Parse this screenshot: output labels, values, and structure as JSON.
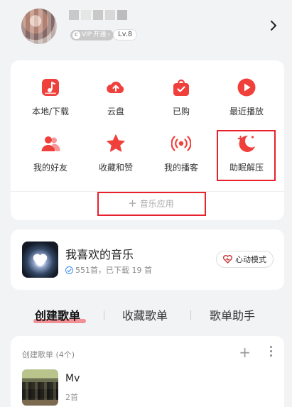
{
  "profile": {
    "vip_badge": "开通",
    "vip_badge_logo": "VIP",
    "level": "Lv.8"
  },
  "grid": {
    "items": [
      {
        "label": "本地/下载",
        "icon": "music-file-icon"
      },
      {
        "label": "云盘",
        "icon": "cloud-upload-icon"
      },
      {
        "label": "已购",
        "icon": "shopping-bag-icon"
      },
      {
        "label": "最近播放",
        "icon": "play-circle-icon"
      },
      {
        "label": "我的好友",
        "icon": "friends-icon"
      },
      {
        "label": "收藏和赞",
        "icon": "star-icon"
      },
      {
        "label": "我的播客",
        "icon": "podcast-icon"
      },
      {
        "label": "助眠解压",
        "icon": "moon-icon"
      }
    ],
    "music_app": "音乐应用",
    "accent_color": "#f0403c"
  },
  "liked": {
    "title": "我喜欢的音乐",
    "subtitle": "551首，已下载 19 首",
    "heart_mode": "心动模式"
  },
  "tabs": [
    {
      "label": "创建歌单",
      "active": true
    },
    {
      "label": "收藏歌单",
      "active": false
    },
    {
      "label": "歌单助手",
      "active": false
    }
  ],
  "playlists": {
    "header": "创建歌单 (4个)",
    "items": [
      {
        "title": "Mv",
        "count": "2首"
      }
    ]
  }
}
